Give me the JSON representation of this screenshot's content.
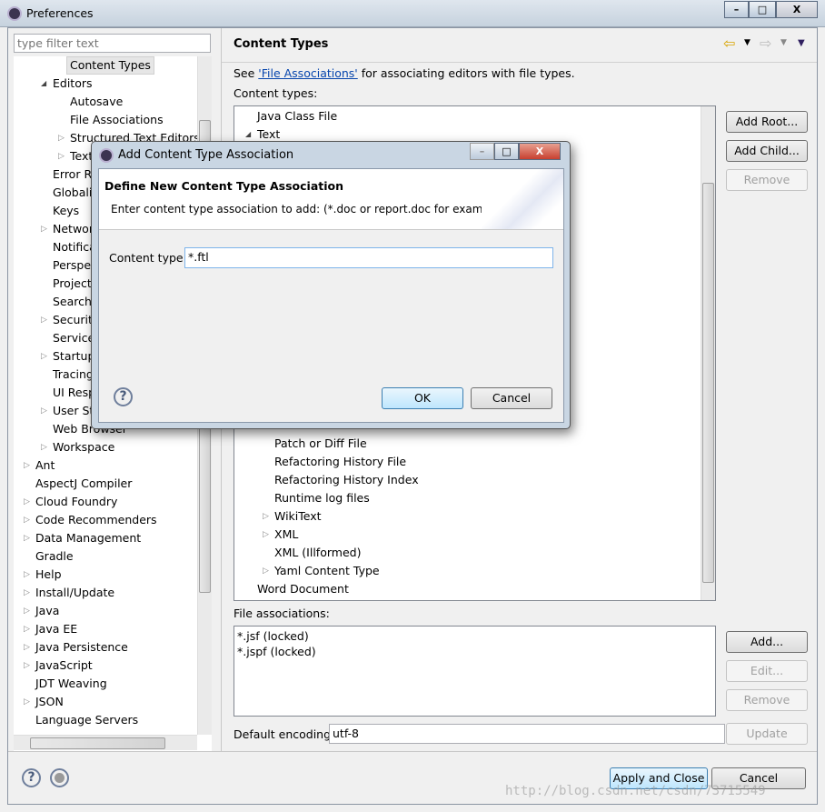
{
  "window": {
    "title": "Preferences"
  },
  "left": {
    "filter_placeholder": "type filter text",
    "items": [
      {
        "label": "Content Types",
        "indent": 2,
        "selected": true
      },
      {
        "label": "Editors",
        "indent": 1,
        "expander": "expanded"
      },
      {
        "label": "Autosave",
        "indent": 2
      },
      {
        "label": "File Associations",
        "indent": 2
      },
      {
        "label": "Structured Text Editors",
        "indent": 2,
        "expander": "collapsed"
      },
      {
        "label": "Text",
        "indent": 2,
        "expander": "collapsed"
      },
      {
        "label": "Error R",
        "indent": 1
      },
      {
        "label": "Globali",
        "indent": 1
      },
      {
        "label": "Keys",
        "indent": 1
      },
      {
        "label": "Networ",
        "indent": 1,
        "expander": "collapsed"
      },
      {
        "label": "Notifica",
        "indent": 1
      },
      {
        "label": "Perspe",
        "indent": 1
      },
      {
        "label": "Project",
        "indent": 1
      },
      {
        "label": "Search",
        "indent": 1
      },
      {
        "label": "Security",
        "indent": 1,
        "expander": "collapsed"
      },
      {
        "label": "Service",
        "indent": 1
      },
      {
        "label": "Startup",
        "indent": 1,
        "expander": "collapsed"
      },
      {
        "label": "Tracing",
        "indent": 1
      },
      {
        "label": "UI Resp",
        "indent": 1
      },
      {
        "label": "User St",
        "indent": 1,
        "expander": "collapsed"
      },
      {
        "label": "Web Browser",
        "indent": 1
      },
      {
        "label": "Workspace",
        "indent": 1,
        "expander": "collapsed"
      },
      {
        "label": "Ant",
        "indent": 0,
        "expander": "collapsed"
      },
      {
        "label": "AspectJ Compiler",
        "indent": 0
      },
      {
        "label": "Cloud Foundry",
        "indent": 0,
        "expander": "collapsed"
      },
      {
        "label": "Code Recommenders",
        "indent": 0,
        "expander": "collapsed"
      },
      {
        "label": "Data Management",
        "indent": 0,
        "expander": "collapsed"
      },
      {
        "label": "Gradle",
        "indent": 0
      },
      {
        "label": "Help",
        "indent": 0,
        "expander": "collapsed"
      },
      {
        "label": "Install/Update",
        "indent": 0,
        "expander": "collapsed"
      },
      {
        "label": "Java",
        "indent": 0,
        "expander": "collapsed"
      },
      {
        "label": "Java EE",
        "indent": 0,
        "expander": "collapsed"
      },
      {
        "label": "Java Persistence",
        "indent": 0,
        "expander": "collapsed"
      },
      {
        "label": "JavaScript",
        "indent": 0,
        "expander": "collapsed"
      },
      {
        "label": "JDT Weaving",
        "indent": 0
      },
      {
        "label": "JSON",
        "indent": 0,
        "expander": "collapsed"
      },
      {
        "label": "Language Servers",
        "indent": 0
      }
    ]
  },
  "main": {
    "title": "Content Types",
    "desc_prefix": "See ",
    "desc_link": "'File Associations'",
    "desc_suffix": " for associating editors with file types.",
    "content_types_label": "Content types:",
    "tree_top": [
      {
        "label": "Java Class File",
        "indent": 0
      },
      {
        "label": "Text",
        "indent": 0,
        "expander": "expanded"
      }
    ],
    "tree_bottom": [
      {
        "label": "Patch or Diff File",
        "indent": 1
      },
      {
        "label": "Refactoring History File",
        "indent": 1
      },
      {
        "label": "Refactoring History Index",
        "indent": 1
      },
      {
        "label": "Runtime log files",
        "indent": 1
      },
      {
        "label": "WikiText",
        "indent": 1,
        "expander": "collapsed"
      },
      {
        "label": "XML",
        "indent": 1,
        "expander": "collapsed"
      },
      {
        "label": "XML (Illformed)",
        "indent": 1
      },
      {
        "label": "Yaml Content Type",
        "indent": 1,
        "expander": "collapsed"
      },
      {
        "label": "Word Document",
        "indent": 0
      }
    ],
    "add_root": "Add Root...",
    "add_child": "Add Child...",
    "remove": "Remove",
    "file_assoc_label": "File associations:",
    "file_assocs": [
      "*.jsf (locked)",
      "*.jspf (locked)"
    ],
    "add": "Add...",
    "edit": "Edit...",
    "remove2": "Remove",
    "encoding_label": "Default encoding:",
    "encoding_value": "utf-8",
    "update": "Update"
  },
  "footer": {
    "apply_close": "Apply and Close",
    "cancel": "Cancel"
  },
  "dialog": {
    "title": "Add Content Type Association",
    "heading": "Define New Content Type Association",
    "message": "Enter content type association to add: (*.doc or report.doc for example)",
    "field_label": "Content type:",
    "field_value": "*.ftl",
    "ok": "OK",
    "cancel": "Cancel"
  },
  "watermark": "http://blog.csdn.net/csdn/73715549"
}
